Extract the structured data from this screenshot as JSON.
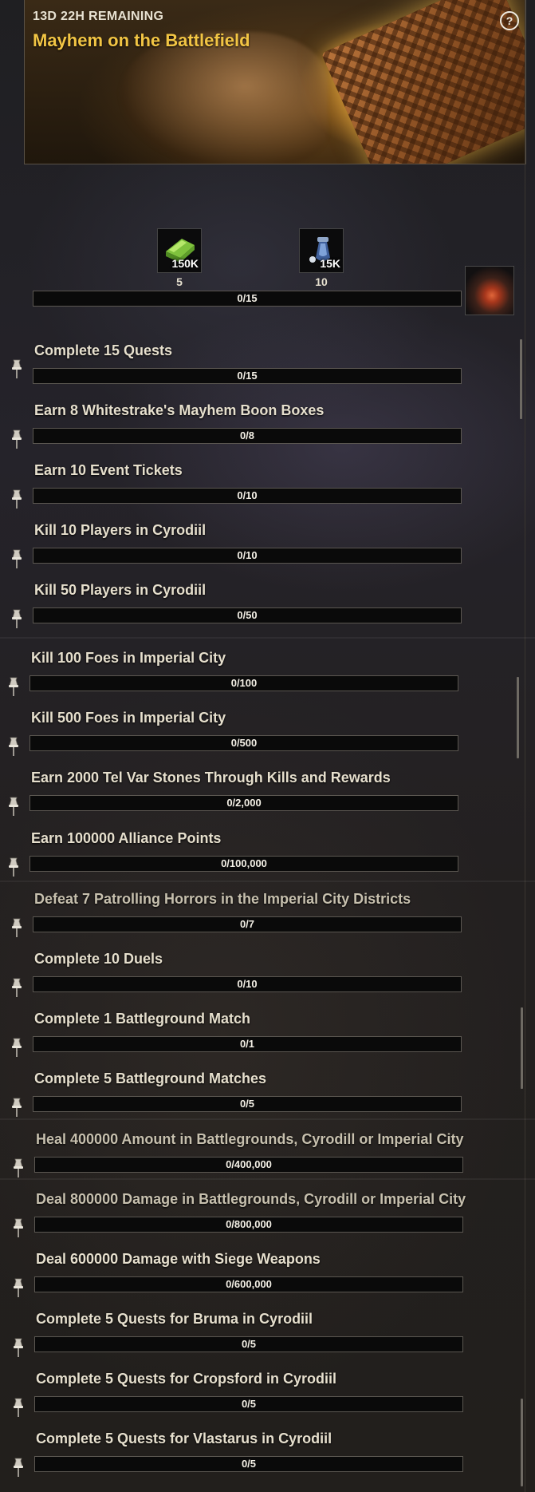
{
  "event": {
    "time_remaining": "13D 22H REMAINING",
    "title": "Mayhem on the Battlefield",
    "help_icon": "question-mark-icon",
    "accent_color": "#f2c544"
  },
  "rewards": [
    {
      "icon": "tel-var-stones-icon",
      "amount": "150K",
      "tier": "5"
    },
    {
      "icon": "alliance-points-icon",
      "amount": "15K",
      "tier": "10"
    },
    {
      "icon": "mayhem-final-reward-icon",
      "amount": "",
      "tier": ""
    }
  ],
  "overall_progress": {
    "text": "0/15",
    "fraction": 0
  },
  "tasks": [
    {
      "title": "Complete 15 Quests",
      "progress": "0/15",
      "fraction": 0
    },
    {
      "title": "Earn 8 Whitestrake's Mayhem Boon Boxes",
      "progress": "0/8",
      "fraction": 0
    },
    {
      "title": "Earn 10 Event Tickets",
      "progress": "0/10",
      "fraction": 0
    },
    {
      "title": "Kill 10 Players in Cyrodiil",
      "progress": "0/10",
      "fraction": 0
    },
    {
      "title": "Kill 50 Players in Cyrodiil",
      "progress": "0/50",
      "fraction": 0
    },
    {
      "title": "Kill 100 Foes in Imperial City",
      "progress": "0/100",
      "fraction": 0
    },
    {
      "title": "Kill 500 Foes in Imperial City",
      "progress": "0/500",
      "fraction": 0
    },
    {
      "title": "Earn 2000 Tel Var Stones Through Kills and Rewards",
      "progress": "0/2,000",
      "fraction": 0
    },
    {
      "title": "Earn 100000 Alliance Points",
      "progress": "0/100,000",
      "fraction": 0
    },
    {
      "title": "Defeat 7 Patrolling Horrors in the Imperial City Districts",
      "progress": "0/7",
      "fraction": 0
    },
    {
      "title": "Complete 10 Duels",
      "progress": "0/10",
      "fraction": 0
    },
    {
      "title": "Complete 1 Battleground Match",
      "progress": "0/1",
      "fraction": 0
    },
    {
      "title": "Complete 5 Battleground Matches",
      "progress": "0/5",
      "fraction": 0
    },
    {
      "title": "Heal 400000 Amount in Battlegrounds, Cyrodill or Imperial City",
      "progress": "0/400,000",
      "fraction": 0
    },
    {
      "title": "Deal 800000 Damage in Battlegrounds, Cyrodill or Imperial City",
      "progress": "0/800,000",
      "fraction": 0
    },
    {
      "title": "Deal 600000 Damage with Siege Weapons",
      "progress": "0/600,000",
      "fraction": 0
    },
    {
      "title": "Complete 5 Quests for Bruma in Cyrodiil",
      "progress": "0/5",
      "fraction": 0
    },
    {
      "title": "Complete 5 Quests for Cropsford in Cyrodiil",
      "progress": "0/5",
      "fraction": 0
    },
    {
      "title": "Complete 5 Quests for Vlastarus in Cyrodiil",
      "progress": "0/5",
      "fraction": 0
    }
  ]
}
